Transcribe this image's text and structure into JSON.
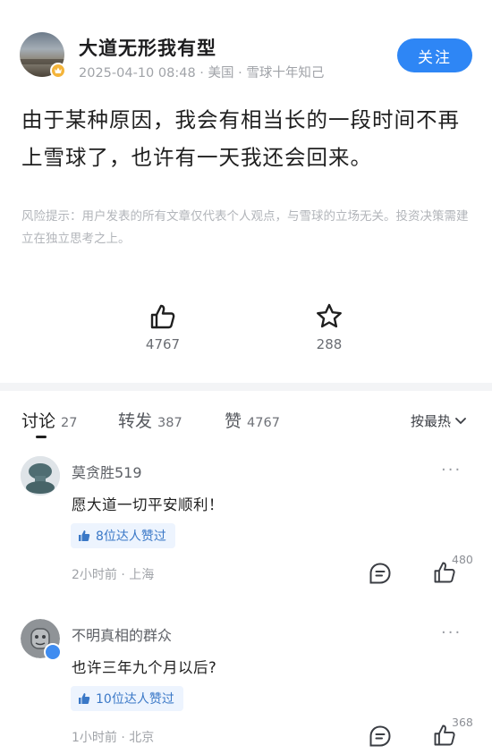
{
  "post": {
    "author_name": "大道无形我有型",
    "meta": "2025-04-10 08:48 · 美国 · 雪球十年知己",
    "follow_label": "关注",
    "content": "由于某种原因，我会有相当长的一段时间不再上雪球了，也许有一天我还会回来。",
    "risk_note": "风险提示：用户发表的所有文章仅代表个人观点，与雪球的立场无关。投资决策需建立在独立思考之上。",
    "like_count": "4767",
    "favorite_count": "288"
  },
  "tabs": [
    {
      "label": "讨论",
      "count": "27"
    },
    {
      "label": "转发",
      "count": "387"
    },
    {
      "label": "赞",
      "count": "4767"
    }
  ],
  "sort_label": "按最热",
  "comments": [
    {
      "name": "莫贪胜519",
      "text": "愿大道一切平安顺利！",
      "liked_by": "8位达人赞过",
      "meta": "2小时前 · 上海",
      "likes": "480"
    },
    {
      "name": "不明真相的群众",
      "text": "也许三年九个月以后?",
      "liked_by": "10位达人赞过",
      "meta": "1小时前 · 北京",
      "likes": "368"
    }
  ],
  "more_label": "···",
  "colors": {
    "accent": "#2e86f5",
    "badge": "#f4b43a",
    "pill_bg": "#edf4fe",
    "pill_text": "#3a78c7"
  },
  "icons": [
    "thumb-up-icon",
    "star-icon",
    "chevron-down-icon",
    "reply-icon",
    "more-icon",
    "vip-badge-icon"
  ]
}
